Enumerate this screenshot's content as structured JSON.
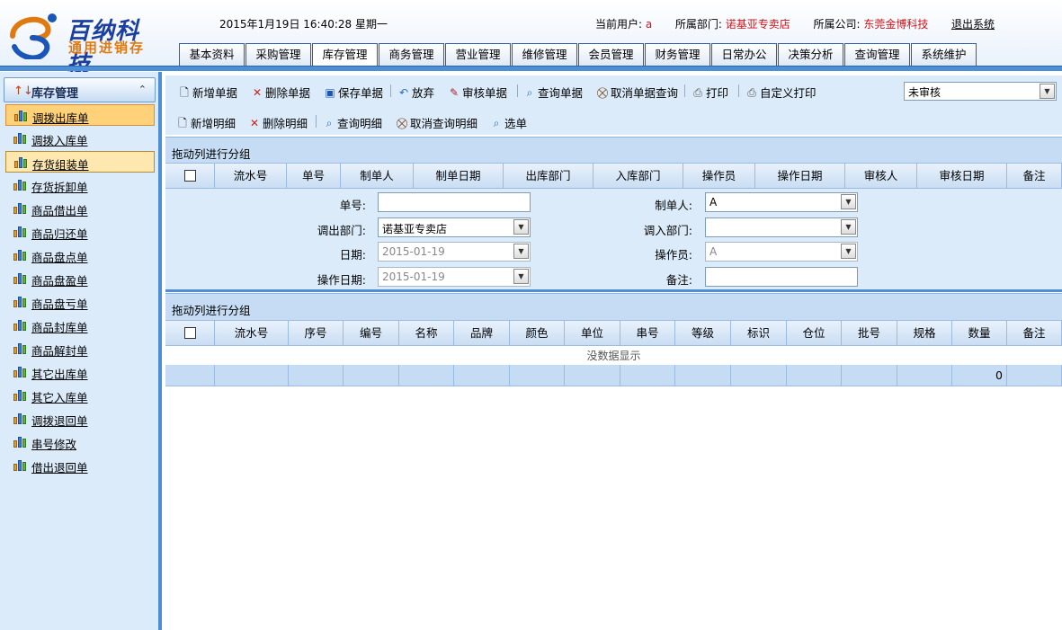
{
  "header": {
    "logo_title": "百纳科技",
    "logo_subtitle": "通用进销存",
    "datetime": "2015年1月19日 16:40:28 星期一",
    "current_user_label": "当前用户:",
    "current_user": "a",
    "dept_label": "所属部门:",
    "dept": "诺基亚专卖店",
    "company_label": "所属公司:",
    "company": "东莞金博科技",
    "logout": "退出系统"
  },
  "nav_tabs": [
    "基本资料",
    "采购管理",
    "库存管理",
    "商务管理",
    "营业管理",
    "维修管理",
    "会员管理",
    "财务管理",
    "日常办公",
    "决策分析",
    "查询管理",
    "系统维护"
  ],
  "active_tab": "库存管理",
  "sidebar": {
    "title": "库存管理",
    "items": [
      "调拨出库单",
      "调拨入库单",
      "存货组装单",
      "存货拆卸单",
      "商品借出单",
      "商品归还单",
      "商品盘点单",
      "商品盘盈单",
      "商品盘亏单",
      "商品封库单",
      "商品解封单",
      "其它出库单",
      "其它入库单",
      "调拨退回单",
      "串号修改",
      "借出退回单"
    ]
  },
  "toolbar1": {
    "new": "新增单据",
    "delete": "删除单据",
    "save": "保存单据",
    "discard": "放弃",
    "audit": "审核单据",
    "query": "查询单据",
    "cancel_query": "取消单据查询",
    "print": "打印",
    "custom_print": "自定义打印",
    "status_value": "未审核"
  },
  "toolbar2": {
    "new_detail": "新增明细",
    "delete_detail": "删除明细",
    "query_detail": "查询明细",
    "cancel_query_detail": "取消查询明细",
    "select": "选单"
  },
  "group_hint": "拖动列进行分组",
  "header_grid": {
    "columns": [
      "流水号",
      "单号",
      "制单人",
      "制单日期",
      "出库部门",
      "入库部门",
      "操作员",
      "操作日期",
      "审核人",
      "审核日期",
      "备注"
    ]
  },
  "form": {
    "order_no_label": "单号:",
    "order_no": "",
    "maker_label": "制单人:",
    "maker": "A",
    "out_dept_label": "调出部门:",
    "out_dept": "诺基亚专卖店",
    "in_dept_label": "调入部门:",
    "in_dept": "",
    "date_label": "日期:",
    "date": "2015-01-19",
    "operator_label": "操作员:",
    "operator": "A",
    "op_date_label": "操作日期:",
    "op_date": "2015-01-19",
    "remark_label": "备注:",
    "remark": ""
  },
  "detail_grid": {
    "columns": [
      "流水号",
      "序号",
      "编号",
      "名称",
      "品牌",
      "颜色",
      "单位",
      "串号",
      "等级",
      "标识",
      "仓位",
      "批号",
      "规格",
      "数量",
      "备注"
    ],
    "empty_text": "没数据显示",
    "quantity_total": "0"
  },
  "colors": {
    "accent_blue": "#4d8fd6",
    "panel_bg": "#dcebfa",
    "highlight": "#ffd27a",
    "red_text": "#d0141b"
  }
}
